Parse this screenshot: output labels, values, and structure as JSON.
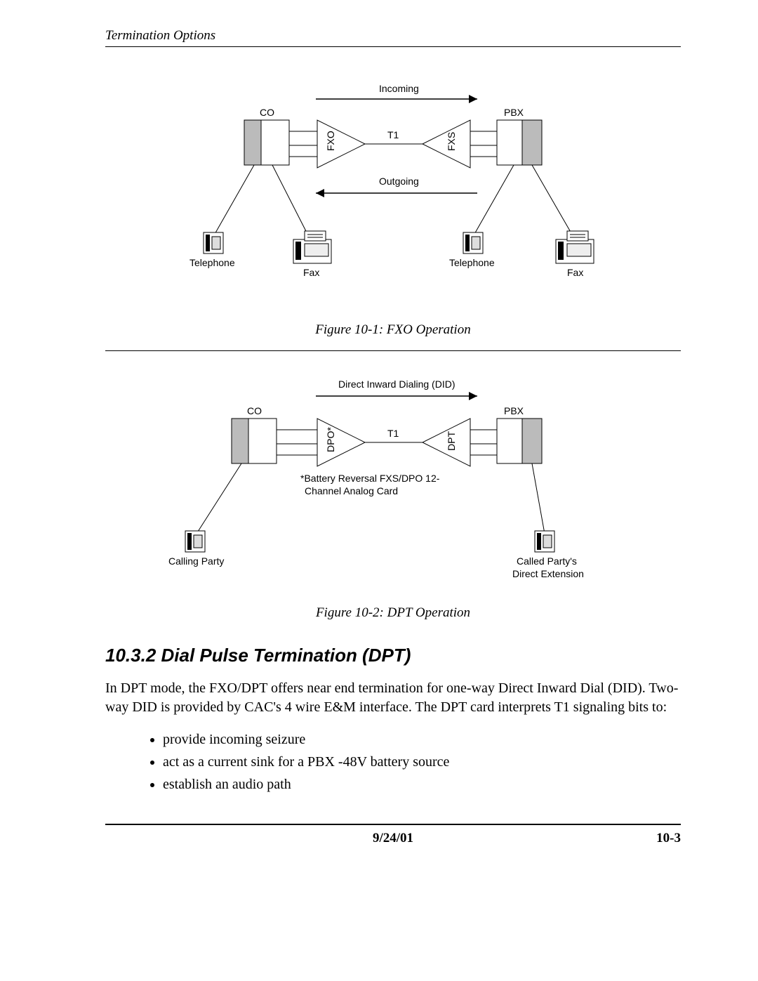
{
  "header": {
    "running": "Termination Options"
  },
  "figure1": {
    "caption": "Figure 10-1: FXO Operation",
    "labels": {
      "incoming": "Incoming",
      "outgoing": "Outgoing",
      "t1": "T1",
      "co": "CO",
      "pbx": "PBX",
      "fxo": "FXO",
      "fxs": "FXS",
      "telephone_left": "Telephone",
      "telephone_right": "Telephone",
      "fax_left": "Fax",
      "fax_right": "Fax"
    }
  },
  "figure2": {
    "caption": "Figure 10-2: DPT Operation",
    "labels": {
      "did": "Direct Inward Dialing (DID)",
      "t1": "T1",
      "co": "CO",
      "pbx": "PBX",
      "dpo": "DPO*",
      "dpt": "DPT",
      "note1": "*Battery Reversal FXS/DPO 12-",
      "note2": "Channel Analog Card",
      "calling": "Calling Party",
      "called1": "Called Party's",
      "called2": "Direct Extension"
    }
  },
  "section": {
    "title": "10.3.2  Dial Pulse Termination (DPT)",
    "para": "In DPT mode, the FXO/DPT offers near end termination for one-way Direct Inward Dial (DID). Two-way DID is provided by CAC's 4 wire E&M interface. The DPT card interprets T1 signaling bits to:",
    "bullets": [
      "provide incoming seizure",
      "act as a current sink for a PBX -48V battery source",
      "establish an audio path"
    ]
  },
  "footer": {
    "date": "9/24/01",
    "page": "10-3"
  }
}
